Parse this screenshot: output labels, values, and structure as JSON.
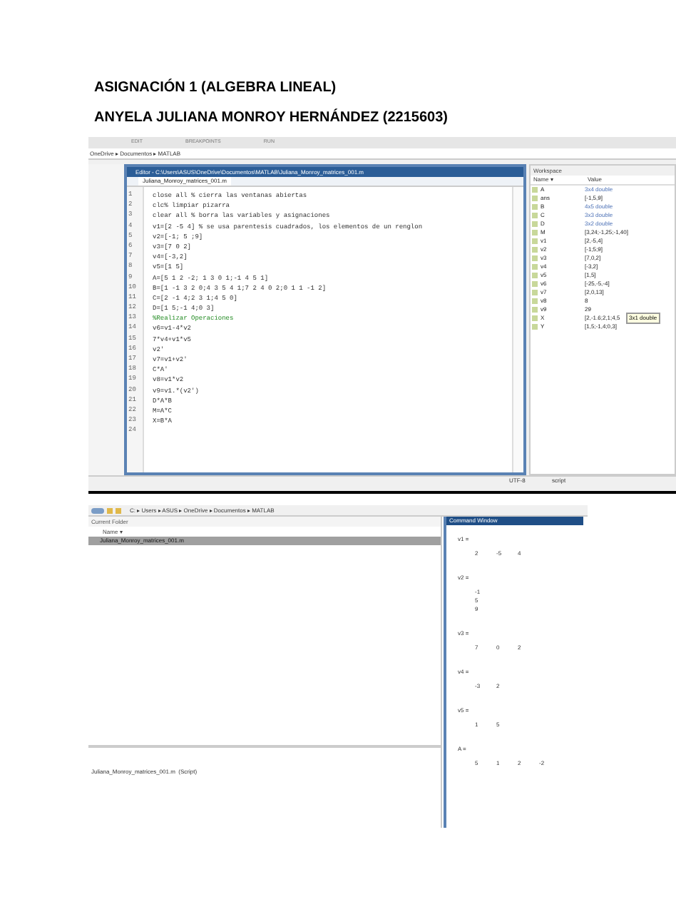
{
  "title": "ASIGNACIÓN 1 (ALGEBRA LINEAL)",
  "author": "ANYELA JULIANA MONROY HERNÁNDEZ (2215603)",
  "shot1": {
    "toolstrip_tabs": [
      "EDIT",
      "BREAKPOINTS",
      "RUN"
    ],
    "path": "OneDrive ▸ Documentos ▸ MATLAB",
    "editor": {
      "title": "Editor - C:\\Users\\ASUS\\OneDrive\\Documentos\\MATLAB\\Juliana_Monroy_matrices_001.m",
      "tab": "Juliana_Monroy_matrices_001.m",
      "lines": [
        {
          "n": "1",
          "code": "close all % cierra las ventanas abiertas"
        },
        {
          "n": "2",
          "code": "clc% limpiar pizarra"
        },
        {
          "n": "3",
          "code": "clear all % borra las variables y asignaciones"
        },
        {
          "n": "4",
          "code": "v1=[2 -5 4] % se usa parentesis cuadrados, los elementos de un renglon"
        },
        {
          "n": "5",
          "code": "v2=[-1; 5 ;9]"
        },
        {
          "n": "6",
          "code": "v3=[7 0 2]"
        },
        {
          "n": "7",
          "code": "v4=[-3,2]"
        },
        {
          "n": "8",
          "code": "v5=[1 5]"
        },
        {
          "n": "9",
          "code": "A=[5 1 2 -2; 1 3 0 1;-1 4 5 1]"
        },
        {
          "n": "10",
          "code": "B=[1 -1 3 2 0;4 3 5 4 1;7 2 4 0 2;0 1 1 -1 2]"
        },
        {
          "n": "11",
          "code": "C=[2 -1 4;2 3 1;4 5 0]"
        },
        {
          "n": "12",
          "code": "D=[1 5;-1 4;0 3]"
        },
        {
          "n": "13",
          "code": "%Realizar Operaciones"
        },
        {
          "n": "14",
          "code": "v6=v1-4*v2"
        },
        {
          "n": "15",
          "code": "7*v4+v1*v5"
        },
        {
          "n": "16",
          "code": "v2'"
        },
        {
          "n": "17",
          "code": "v7=v1+v2'"
        },
        {
          "n": "18",
          "code": "C*A'"
        },
        {
          "n": "19",
          "code": "v8=v1*v2"
        },
        {
          "n": "20",
          "code": "v9=v1.*(v2')"
        },
        {
          "n": "21",
          "code": "D*A*B"
        },
        {
          "n": "22",
          "code": "M=A*C"
        },
        {
          "n": "23",
          "code": "X=B*A"
        },
        {
          "n": "24"
        }
      ]
    },
    "workspace": {
      "title": "Workspace",
      "columns": [
        "Name ▾",
        "Value"
      ],
      "rows": [
        {
          "name": "A",
          "value": "3x4 double"
        },
        {
          "name": "ans",
          "value": "[-1,5,9]"
        },
        {
          "name": "B",
          "value": "4x5 double"
        },
        {
          "name": "C",
          "value": "3x3 double"
        },
        {
          "name": "D",
          "value": "3x2 double"
        },
        {
          "name": "M",
          "value": "[3,24;-1,25;-1,40]"
        },
        {
          "name": "v1",
          "value": "[2,-5,4]"
        },
        {
          "name": "v2",
          "value": "[-1;5;9]"
        },
        {
          "name": "v3",
          "value": "[7,0,2]"
        },
        {
          "name": "v4",
          "value": "[-3,2]"
        },
        {
          "name": "v5",
          "value": "[1,5]"
        },
        {
          "name": "v6",
          "value": "[-25,-5,-4]"
        },
        {
          "name": "v7",
          "value": "[2,0,13]"
        },
        {
          "name": "v8",
          "value": "8"
        },
        {
          "name": "v9",
          "value": "29"
        },
        {
          "name": "X",
          "value": "[2,-1.6;2,1;4,5"
        },
        {
          "name": "Y",
          "value": "[1,5;-1,4;0,3]"
        }
      ],
      "tooltip": "3x1 double"
    },
    "status": [
      "UTF-8",
      "script"
    ]
  },
  "shot2": {
    "path": "C: ▸ Users ▸ ASUS ▸ OneDrive ▸ Documentos ▸ MATLAB",
    "current_folder": {
      "title": "Current Folder",
      "column": "Name ▾",
      "files": [
        {
          "name": "Juliana_Monroy_matrices_001.m",
          "selected": true
        }
      ],
      "details": "Juliana_Monroy_matrices_001.m  (Script)"
    },
    "command_window": {
      "title": "Command Window",
      "outputs": [
        {
          "label": "v1 =",
          "rows": [
            [
              "2",
              "-5",
              "4"
            ]
          ]
        },
        {
          "label": "v2 =",
          "rows": [
            [
              "-1"
            ],
            [
              "5"
            ],
            [
              "9"
            ]
          ]
        },
        {
          "label": "v3 =",
          "rows": [
            [
              "7",
              "0",
              "2"
            ]
          ]
        },
        {
          "label": "v4 =",
          "rows": [
            [
              "-3",
              "2"
            ]
          ]
        },
        {
          "label": "v5 =",
          "rows": [
            [
              "1",
              "5"
            ]
          ]
        },
        {
          "label": "A =",
          "rows": [
            [
              "5",
              "1",
              "2",
              "-2"
            ]
          ]
        }
      ]
    }
  }
}
